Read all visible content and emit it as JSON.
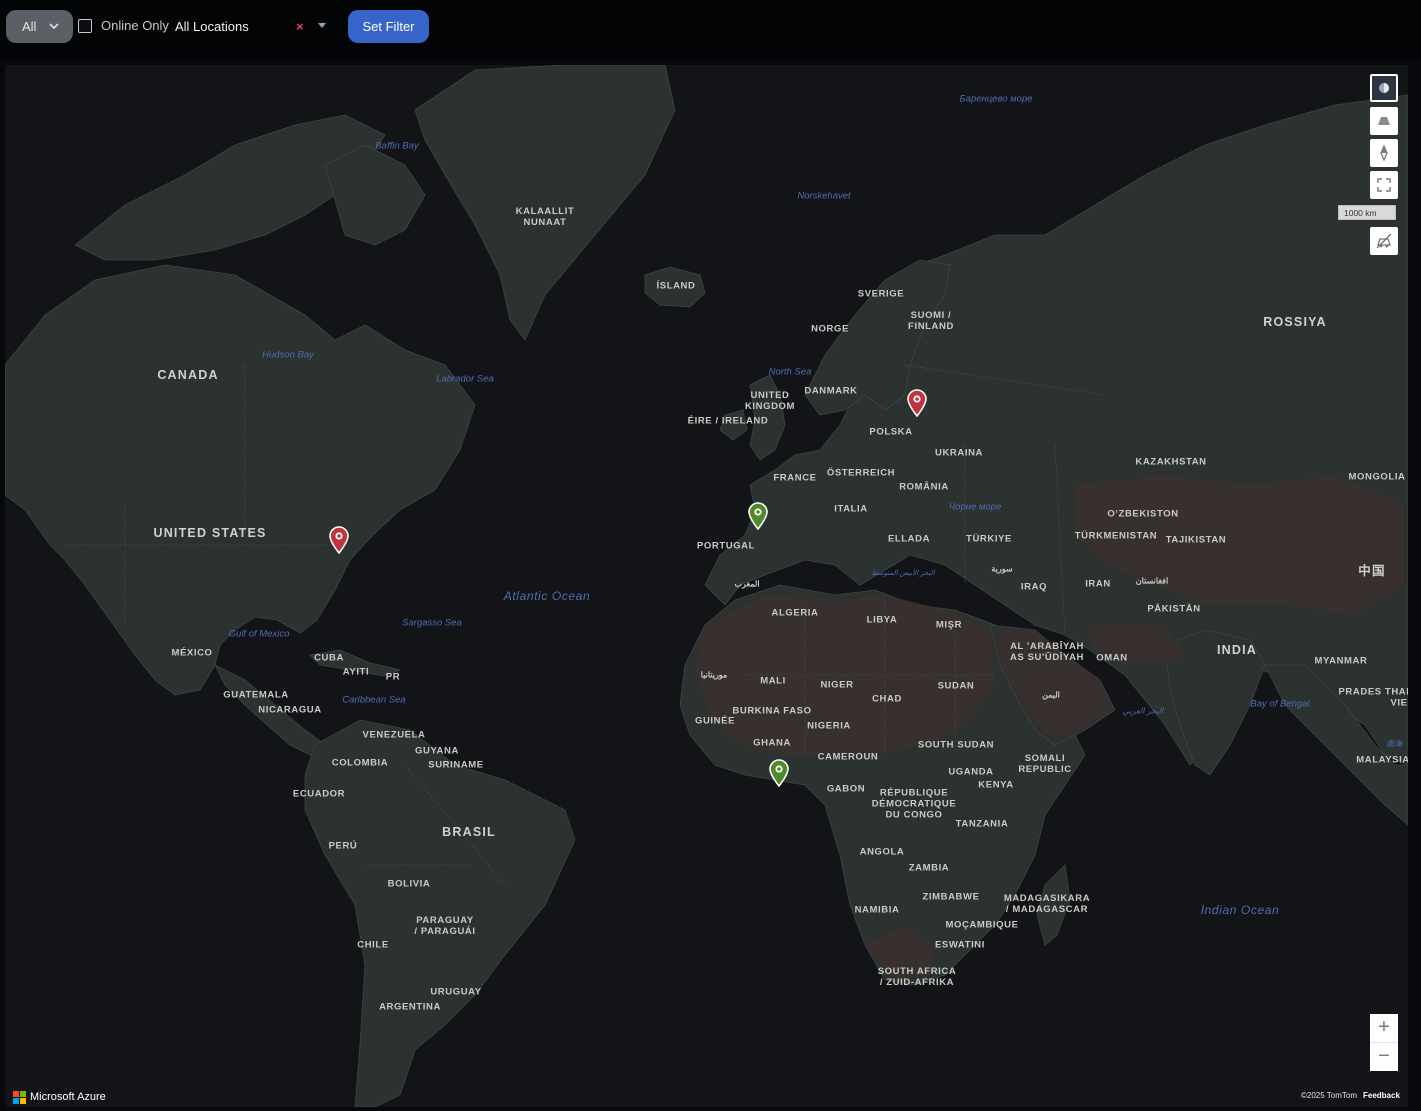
{
  "toolbar": {
    "view_select": "All",
    "online_only_label": "Online Only",
    "online_only_checked": false,
    "location_value": "All Locations",
    "clear_glyph": "×",
    "set_filter_label": "Set Filter"
  },
  "map": {
    "country_labels": {
      "kalaallit": "KALAALLIT\nNUNAAT",
      "island": "ÍSLAND",
      "canada": "CANADA",
      "united_states": "UNITED STATES",
      "mexico": "MÉXICO",
      "cuba": "CUBA",
      "ayiti": "AYITI",
      "pr": "PR",
      "guatemala": "GUATEMALA",
      "nicaragua": "NICARAGUA",
      "venezuela": "VENEZUELA",
      "guyana": "GUYANA",
      "suriname": "SURINAME",
      "colombia": "COLOMBIA",
      "ecuador": "ECUADOR",
      "peru": "PERÚ",
      "brasil": "BRASIL",
      "bolivia": "BOLIVIA",
      "paraguay": "PARAGUAY\n/ PARAGUÁI",
      "chile": "CHILE",
      "uruguay": "URUGUAY",
      "argentina": "ARGENTINA",
      "sverige": "SVERIGE",
      "suomi": "SUOMI /\nFINLAND",
      "norge": "NORGE",
      "rossiya": "ROSSIYA",
      "danmark": "DANMARK",
      "uk": "UNITED\nKINGDOM",
      "eire": "ÉIRE / IRELAND",
      "polska": "POLSKA",
      "ukraina": "UKRAINA",
      "kazakhstan": "KAZAKHSTAN",
      "mongolia": "MONGOLIA",
      "france": "FRANCE",
      "osterreich": "ÖSTERREICH",
      "romania": "ROMÂNIA",
      "italia": "ITALIA",
      "portugal": "PORTUGAL",
      "ellada": "ELLADA",
      "turkiye": "TÜRKIYE",
      "uzbekiston": "O‘ZBEKISTON",
      "turkmenistan": "TÜRKMENISTAN",
      "tajikistan": "TAJIKISTAN",
      "zhongguo": "中国",
      "iraq": "IRAQ",
      "iran": "IRAN",
      "pakistan": "PĀKISTĀN",
      "india": "INDIA",
      "algeria": "ALGERIA",
      "libya": "LIBYA",
      "misr": "MIŞR",
      "arabiyah": "AL 'ARABĪYAH\nAS SU'ŪDĪYAH",
      "oman": "OMAN",
      "myanmar": "MYANMAR",
      "prades_thai": "PRADES THAI",
      "mali": "MALI",
      "niger": "NIGER",
      "chad": "CHAD",
      "sudan": "SUDAN",
      "burkina": "BURKINA FASO",
      "guinee": "GUINÉE",
      "nigeria": "NIGERIA",
      "ghana": "GHANA",
      "cameroun": "CAMEROUN",
      "south_sudan": "SOUTH SUDAN",
      "somali": "SOMALI\nREPUBLIC",
      "uganda": "UGANDA",
      "kenya": "KENYA",
      "gabon": "GABON",
      "rdc": "RÉPUBLIQUE\nDÉMOCRATIQUE\nDU CONGO",
      "tanzania": "TANZANIA",
      "angola": "ANGOLA",
      "zambia": "ZAMBIA",
      "malaysia": "MALAYSIA",
      "zimbabwe": "ZIMBABWE",
      "namibia": "NAMIBIA",
      "mocambique": "MOÇAMBIQUE",
      "madagasikara": "MADAGASIKARA\n/ MADAGASCAR",
      "eswatini": "ESWATINI",
      "south_africa": "SOUTH AFRICA\n/ ZUID-AFRIKA",
      "maghrib": "المغرب",
      "muritaniya": "موريتانيا",
      "suriya": "سورية",
      "afghanistan": "افغانستان",
      "yaman": "اليمن",
      "vie": "VIE"
    },
    "water_labels": {
      "baffin_bay": "Baffin Bay",
      "barents_sea": "Баренцево море",
      "norskehavet": "Norskehavet",
      "hudson_bay": "Hudson Bay",
      "labrador_sea": "Labrador Sea",
      "north_sea": "North\nSea",
      "atlantic": "Atlantic Ocean",
      "sargasso": "Sargasso Sea",
      "gulf_mexico": "Gulf of\nMexico",
      "caribbean": "Caribbean Sea",
      "black_sea": "Чорне море",
      "mediterranean": "البحر الأبيض المتوسط",
      "arabian_sea": "البحر العربي",
      "bay_bengal": "Bay of\nBengal",
      "indian_ocean": "Indian Ocean",
      "south_china_sea": "南海"
    },
    "markers": [
      {
        "name": "marker-east-us",
        "status": "offline",
        "color": "#c0343f"
      },
      {
        "name": "marker-poland",
        "status": "offline",
        "color": "#c0343f"
      },
      {
        "name": "marker-spain",
        "status": "online",
        "color": "#4f8a2a"
      },
      {
        "name": "marker-gulf-guinea",
        "status": "online",
        "color": "#4f8a2a"
      }
    ],
    "scale_label": "1000 km",
    "zoom_in": "+",
    "zoom_out": "−",
    "brand": "Microsoft Azure",
    "attribution": "©2025 TomTom",
    "feedback": "Feedback",
    "colors": {
      "land": "#2c322f",
      "land_desert": "#3a302e",
      "water": "#131418",
      "offline_marker": "#c0343f",
      "online_marker": "#4f8a2a",
      "set_filter_button": "#3764c8"
    }
  }
}
